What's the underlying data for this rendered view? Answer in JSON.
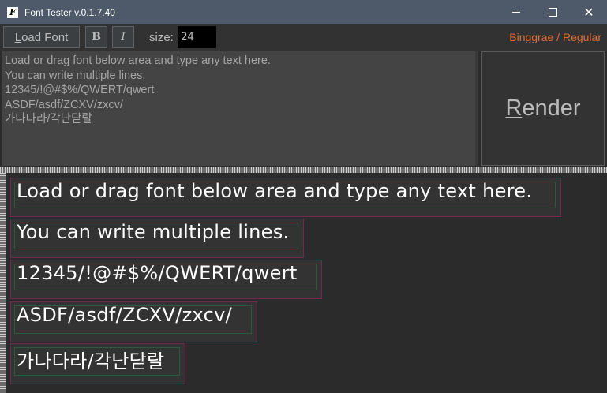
{
  "window": {
    "title": "Font Tester v.0.1.7.40",
    "app_icon": "F",
    "controls": {
      "minimize": "",
      "maximize": "",
      "close": "✕"
    }
  },
  "toolbar": {
    "load_label_u": "L",
    "load_label_rest": "oad Font",
    "bold_label": "B",
    "italic_label": "I",
    "size_label": "size:",
    "size_value": "24",
    "font_name": "Binggrae / Regular"
  },
  "input_text": {
    "lines": [
      "Load or drag font below area and type any text here.",
      "You can write multiple lines.",
      "12345/!@#$%/QWERT/qwert",
      "ASDF/asdf/ZCXV/zxcv/",
      "가나다라/각난닫랄"
    ]
  },
  "render_button": {
    "label_u": "R",
    "label_rest": "ender"
  },
  "output": {
    "lines": [
      "Load or drag font below area and type any text here.",
      "You can write multiple lines.",
      "12345/!@#$%/QWERT/qwert",
      "ASDF/asdf/ZCXV/zxcv/",
      "가나다라/각난닫랄"
    ]
  },
  "colors": {
    "titlebar": "#4e5a6a",
    "font_name": "#e06c35",
    "line_border": "#6e2b4f",
    "baseline_box": "#2c5a3a"
  }
}
